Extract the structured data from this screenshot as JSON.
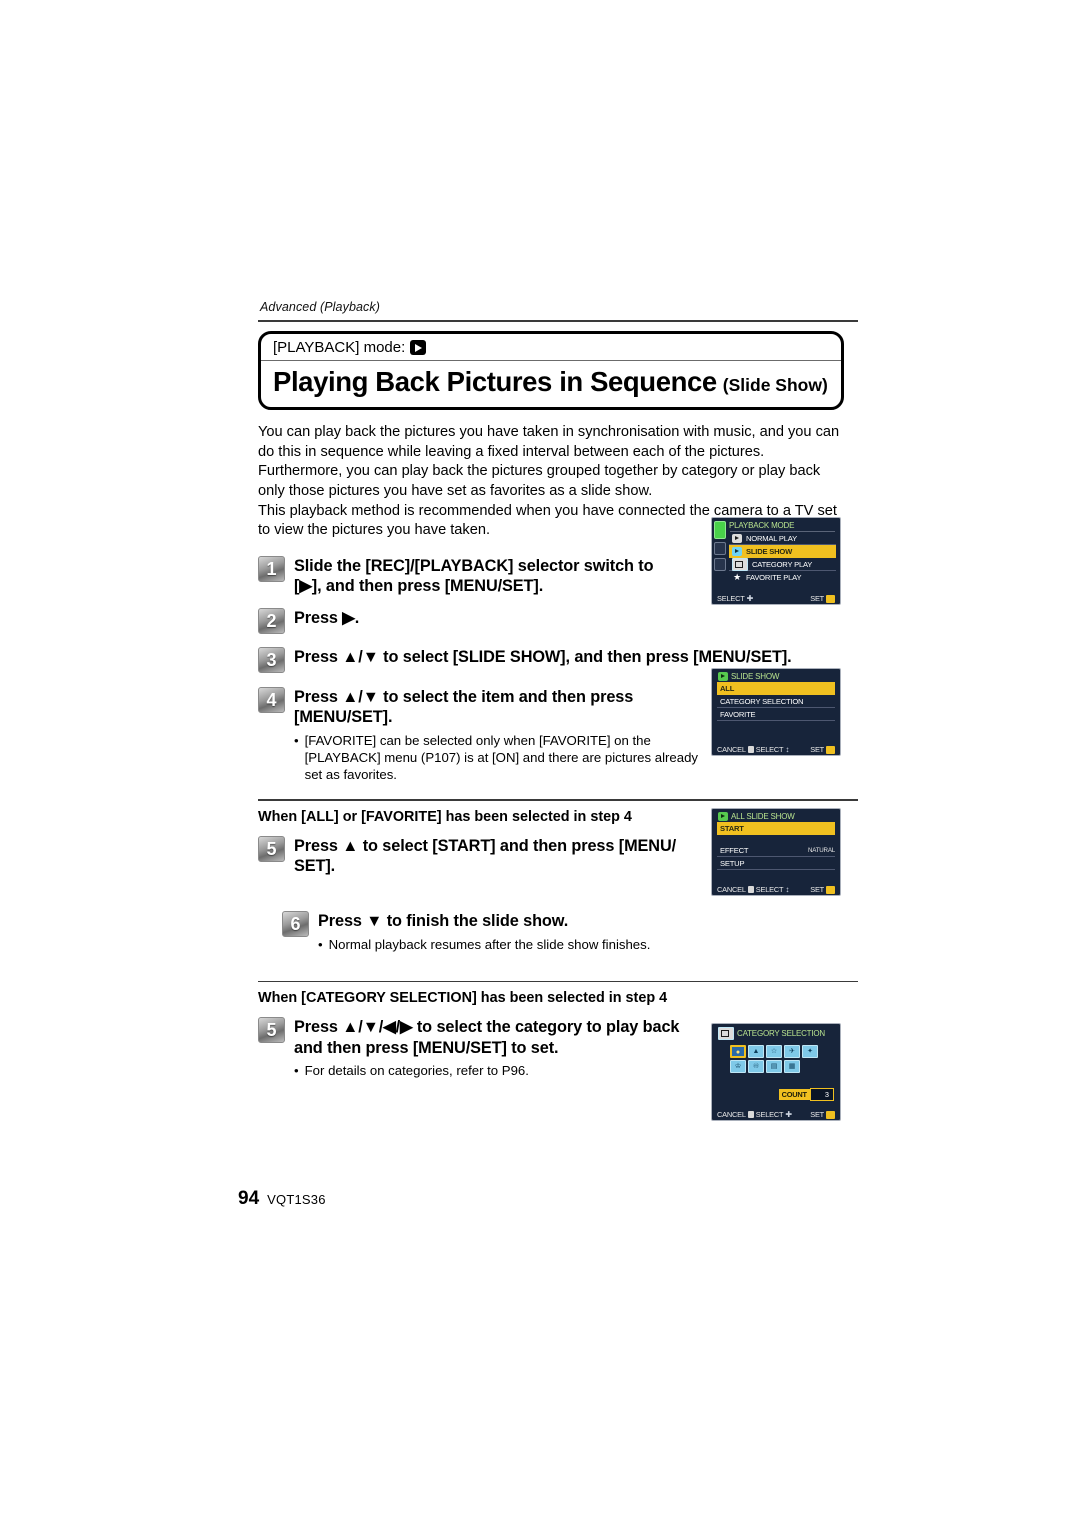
{
  "document": {
    "running_head": "Advanced (Playback)",
    "page_number": "94",
    "page_code": "VQT1S36"
  },
  "title_box": {
    "mode_label": "[PLAYBACK] mode:",
    "mode_icon": "playback-mode-icon",
    "title_main": "Playing Back Pictures in Sequence",
    "title_sub": "(Slide Show)"
  },
  "intro": {
    "lines": [
      "You can play back the pictures you have taken in synchronisation with music, and you can",
      "do this in sequence while leaving a fixed interval between each of the pictures.",
      "Furthermore, you can play back the pictures grouped together by category or play back",
      "only those pictures you have set as favorites as a slide show.",
      "This playback method is recommended when you have connected the camera to a TV set",
      "to view the pictures you have taken."
    ]
  },
  "steps": {
    "step1": {
      "number": "1",
      "line1": "Slide the [REC]/[PLAYBACK] selector switch to",
      "line2": "[▶], and then press [MENU/SET]."
    },
    "step2": {
      "number": "2",
      "line1": "Press ▶."
    },
    "step3": {
      "number": "3",
      "line1": "Press ▲/▼ to select [SLIDE SHOW], and then press [MENU/SET]."
    },
    "step4": {
      "number": "4",
      "line1": "Press ▲/▼ to select the item and then press",
      "line2": "[MENU/SET].",
      "bullet": "[FAVORITE] can be selected only when [FAVORITE] on the [PLAYBACK] menu (P107) is at [ON] and there are pictures already set as favorites."
    },
    "section_all": "When [ALL] or [FAVORITE] has been selected in step 4",
    "step5a": {
      "number": "5",
      "line1": "Press ▲ to select [START] and then press [MENU/",
      "line2": "SET]."
    },
    "step6": {
      "number": "6",
      "line1": "Press ▼ to finish the slide show.",
      "bullet": "Normal playback resumes after the slide show finishes."
    },
    "section_category": "When [CATEGORY SELECTION] has been selected in step 4",
    "step5b": {
      "number": "5",
      "line1": "Press ▲/▼/◀/▶ to select the category to play back",
      "line2": "and then press [MENU/SET] to set.",
      "bullet": "For details on categories, refer to P96."
    }
  },
  "lcd_screens": {
    "playback_mode": {
      "header": "PLAYBACK MODE",
      "rows": [
        {
          "label": "NORMAL PLAY",
          "icon": "normal-play-icon",
          "selected": false
        },
        {
          "label": "SLIDE SHOW",
          "icon": "slide-show-icon",
          "selected": true
        },
        {
          "label": "CATEGORY PLAY",
          "icon": "category-play-icon",
          "selected": false
        },
        {
          "label": "FAVORITE PLAY",
          "icon": "star-icon",
          "selected": false
        }
      ],
      "footer_left": "SELECT",
      "footer_right": "SET"
    },
    "slide_show": {
      "header": "SLIDE SHOW",
      "rows": [
        {
          "label": "ALL",
          "selected": true
        },
        {
          "label": "CATEGORY SELECTION",
          "selected": false
        },
        {
          "label": "FAVORITE",
          "selected": false
        }
      ],
      "footer_cancel": "CANCEL",
      "footer_select": "SELECT",
      "footer_set": "SET"
    },
    "all_slide_show": {
      "header": "ALL SLIDE SHOW",
      "rows": [
        {
          "label": "START",
          "value": "",
          "selected": true
        },
        {
          "label": "EFFECT",
          "value": "NATURAL",
          "selected": false
        },
        {
          "label": "SETUP",
          "value": "",
          "selected": false
        }
      ],
      "footer_cancel": "CANCEL",
      "footer_select": "SELECT",
      "footer_set": "SET"
    },
    "category_selection": {
      "header": "CATEGORY SELECTION",
      "categories_row1": [
        "portrait",
        "scenery",
        "night-portrait",
        "sports",
        "party"
      ],
      "categories_row2": [
        "pet",
        "food",
        "travel",
        "calendar"
      ],
      "count_label": "COUNT",
      "count_value": "3",
      "footer_cancel": "CANCEL",
      "footer_select": "SELECT",
      "footer_set": "SET"
    }
  }
}
